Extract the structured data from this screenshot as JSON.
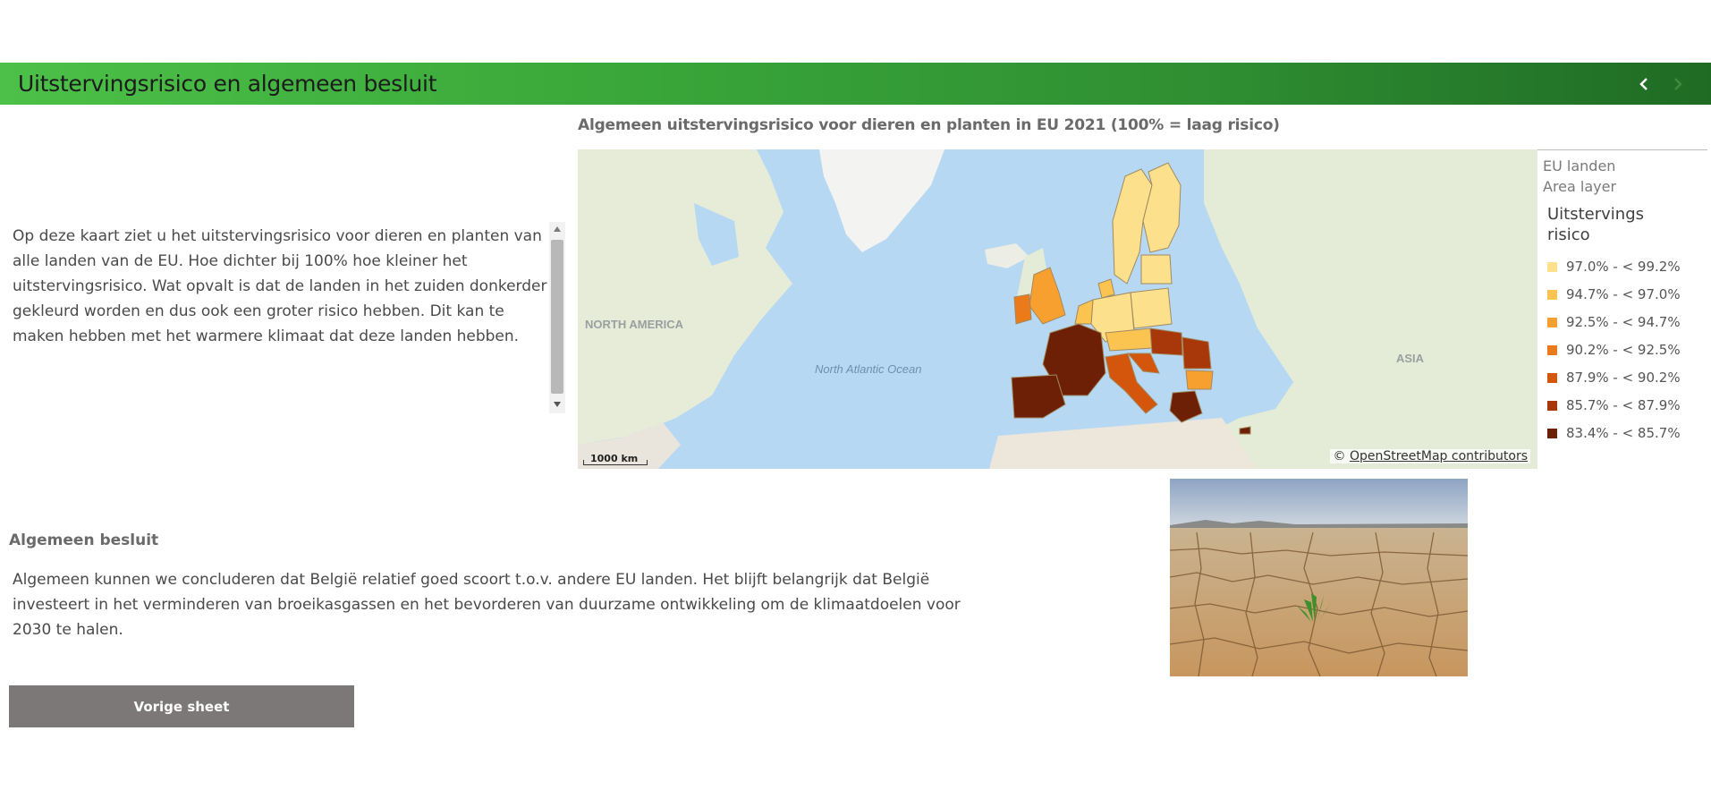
{
  "header": {
    "title": "Uitstervingsrisico en algemeen besluit",
    "prev_icon": "chevron-left-icon",
    "next_icon": "chevron-right-icon",
    "bar_color_start": "#4cc048",
    "bar_color_end": "#1f6b24"
  },
  "intro": {
    "text": "Op deze kaart ziet u het uitstervingsrisico voor dieren en planten van alle landen van de EU. Hoe dichter bij 100% hoe kleiner het uitstervingsrisico. Wat opvalt is dat de landen in het zuiden donkerder gekleurd worden en dus ook een groter risico hebben. Dit kan te maken hebben met het warmere klimaat dat deze landen hebben."
  },
  "map": {
    "title": "Algemeen uitstervingsrisico voor dieren en planten in EU 2021 (100% = laag risico)",
    "labels": {
      "north_america": "NORTH AMERICA",
      "ocean": "North Atlantic Ocean",
      "asia": "ASIA"
    },
    "scale": "1000 km",
    "attribution_prefix": "©",
    "attribution_link": "OpenStreetMap contributors"
  },
  "legend": {
    "layer_name": "EU landen",
    "layer_type": "Area layer",
    "heading": "Uitstervingsrisico",
    "items": [
      {
        "label": "97.0% - < 99.2%",
        "color": "#fde08c"
      },
      {
        "label": "94.7% - < 97.0%",
        "color": "#fbc350"
      },
      {
        "label": "92.5% - < 94.7%",
        "color": "#f7a030"
      },
      {
        "label": "90.2% - < 92.5%",
        "color": "#eb7a1a"
      },
      {
        "label": "87.9% - < 90.2%",
        "color": "#d4560c"
      },
      {
        "label": "85.7% - < 87.9%",
        "color": "#a8380a"
      },
      {
        "label": "83.4% - < 85.7%",
        "color": "#6e2006"
      }
    ]
  },
  "conclusion": {
    "heading": "Algemeen besluit",
    "text": "Algemeen kunnen we concluderen dat België relatief goed scoort t.o.v. andere EU landen. Het blijft belangrijk dat België investeert in het verminderen van broeikasgassen en het bevorderen van duurzame ontwikkeling om de klimaatdoelen voor 2030 te halen."
  },
  "buttons": {
    "prev_sheet": "Vorige sheet"
  }
}
